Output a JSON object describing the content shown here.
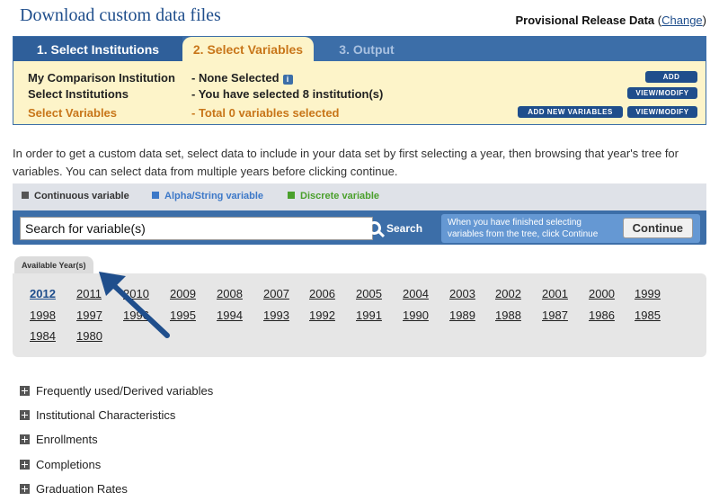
{
  "header": {
    "title": "Download custom data files",
    "release_label": "Provisional Release Data",
    "change_link": "Change"
  },
  "tabs": [
    {
      "label": "1. Select Institutions"
    },
    {
      "label": "2. Select Variables"
    },
    {
      "label": "3. Output"
    }
  ],
  "summary": {
    "rows": [
      {
        "label": "My Comparison Institution",
        "value": "- None Selected"
      },
      {
        "label": "Select Institutions",
        "value": "- You have selected 8 institution(s)"
      },
      {
        "label": "Select Variables",
        "value": "- Total 0 variables selected"
      }
    ],
    "buttons": {
      "add": "ADD",
      "view_modify_1": "VIEW/MODIFY",
      "add_new_variables": "ADD NEW VARIABLES",
      "view_modify_2": "VIEW/MODIFY"
    },
    "info_icon": "i"
  },
  "intro_text": "In order to get a custom data set, select data to include in your data set by first selecting a year, then browsing that year's tree for variables. You can select data from multiple years before clicking continue.",
  "legend": [
    {
      "label": "Continuous variable",
      "color": "#555555"
    },
    {
      "label": "Alpha/String variable",
      "color": "#3c78c8"
    },
    {
      "label": "Discrete variable",
      "color": "#4aa02c"
    }
  ],
  "search": {
    "value": "Search for variable(s)",
    "button_label": "Search",
    "hint": "When you have finished selecting variables from the tree, click Continue",
    "continue_label": "Continue"
  },
  "years": {
    "tab_label": "Available Year(s)",
    "selected": "2012",
    "list": [
      "2012",
      "2011",
      "2010",
      "2009",
      "2008",
      "2007",
      "2006",
      "2005",
      "2004",
      "2003",
      "2002",
      "2001",
      "2000",
      "1999",
      "1998",
      "1997",
      "1996",
      "1995",
      "1994",
      "1993",
      "1992",
      "1991",
      "1990",
      "1989",
      "1988",
      "1987",
      "1986",
      "1985",
      "1984",
      "1980"
    ]
  },
  "tree": [
    {
      "label": "Frequently used/Derived variables"
    },
    {
      "label": "Institutional Characteristics"
    },
    {
      "label": "Enrollments"
    },
    {
      "label": "Completions"
    },
    {
      "label": "Graduation Rates"
    }
  ]
}
